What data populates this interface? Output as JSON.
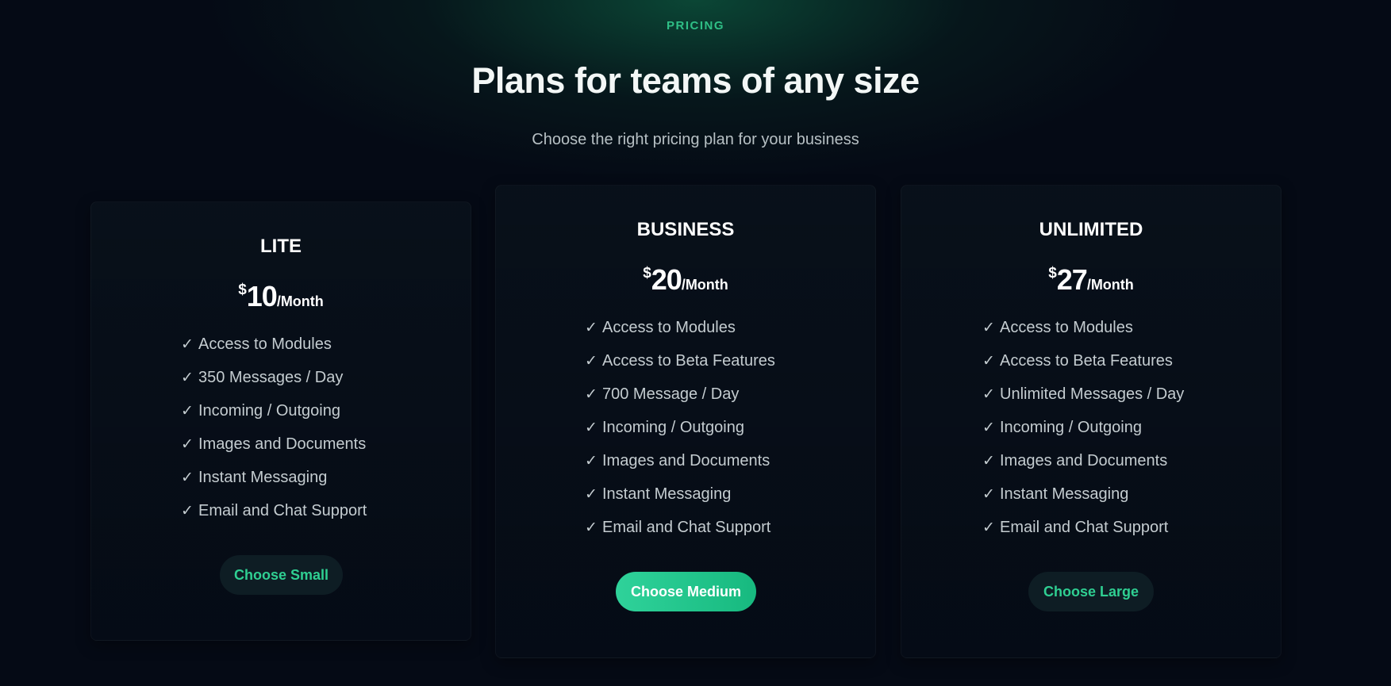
{
  "header": {
    "eyebrow": "PRICING",
    "title": "Plans for teams of any size",
    "subtitle": "Choose the right pricing plan for your business"
  },
  "colors": {
    "accent": "#2fbf86",
    "button_primary": "#1fc68b",
    "background": "#050a15"
  },
  "plans": [
    {
      "name": "LITE",
      "currency": "$",
      "amount": "10",
      "period": "/Month",
      "features": [
        "Access to Modules",
        "350 Messages / Day",
        "Incoming / Outgoing",
        "Images and Documents",
        "Instant Messaging",
        "Email and Chat Support"
      ],
      "button": "Choose Small"
    },
    {
      "name": "BUSINESS",
      "currency": "$",
      "amount": "20",
      "period": "/Month",
      "features": [
        "Access to Modules",
        "Access to Beta Features",
        "700 Message / Day",
        "Incoming / Outgoing",
        "Images and Documents",
        "Instant Messaging",
        "Email and Chat Support"
      ],
      "button": "Choose Medium"
    },
    {
      "name": "UNLIMITED",
      "currency": "$",
      "amount": "27",
      "period": "/Month",
      "features": [
        "Access to Modules",
        "Access to Beta Features",
        "Unlimited Messages / Day",
        "Incoming / Outgoing",
        "Images and Documents",
        "Instant Messaging",
        "Email and Chat Support"
      ],
      "button": "Choose Large"
    }
  ],
  "check_glyph": "✓"
}
